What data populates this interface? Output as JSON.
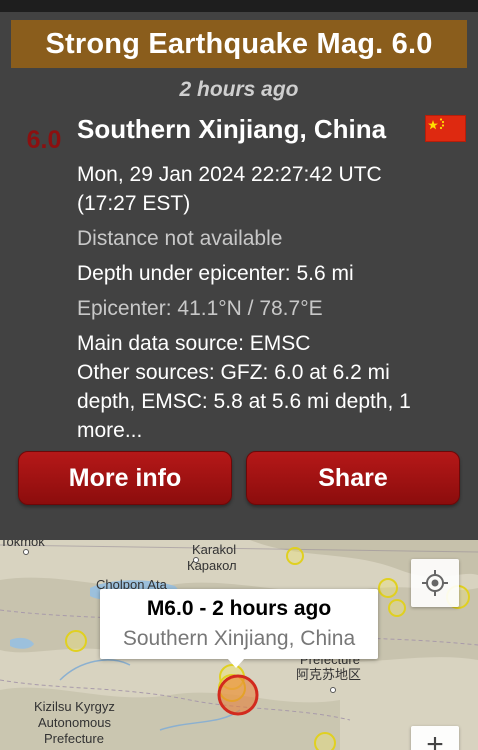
{
  "card": {
    "title": "Strong Earthquake Mag. 6.0",
    "time_ago": "2 hours ago",
    "magnitude": "6.0",
    "location": "Southern Xinjiang, China",
    "flag_icon": "china-flag-icon",
    "details": {
      "datetime_utc": "Mon, 29 Jan 2024 22:27:42 UTC",
      "datetime_local": "(17:27 EST)",
      "distance": "Distance not available",
      "depth": "Depth under epicenter: 5.6 mi",
      "epicenter": "Epicenter: 41.1°N / 78.7°E",
      "main_source": "Main data source: EMSC",
      "other_sources_1": "Other sources: GFZ: 6.0 at 6.2 mi",
      "other_sources_2": "depth, EMSC: 5.8 at 5.6 mi depth, 1",
      "other_sources_3": "more..."
    },
    "buttons": {
      "more_info": "More info",
      "share": "Share"
    },
    "colors": {
      "title_bar": "#8a5d1c",
      "button": "#a01212",
      "magnitude": "#8b1010"
    }
  },
  "map": {
    "labels": {
      "tokmok": "Tokmok",
      "karakol": "Karakol",
      "karakol_ru": "Каракол",
      "cholpon_ata": "Cholpon Ata",
      "prefecture_top": "Prefecture",
      "aksu_cn": "阿克苏地区",
      "kizilsu_1": "Kizilsu Kyrgyz",
      "kizilsu_2": "Autonomous",
      "kizilsu_3": "Prefecture"
    },
    "tooltip": {
      "title": "M6.0  -  2 hours ago",
      "subtitle": "Southern Xinjiang, China"
    },
    "locate_icon": "my-location-icon",
    "zoom_in_label": "+"
  }
}
